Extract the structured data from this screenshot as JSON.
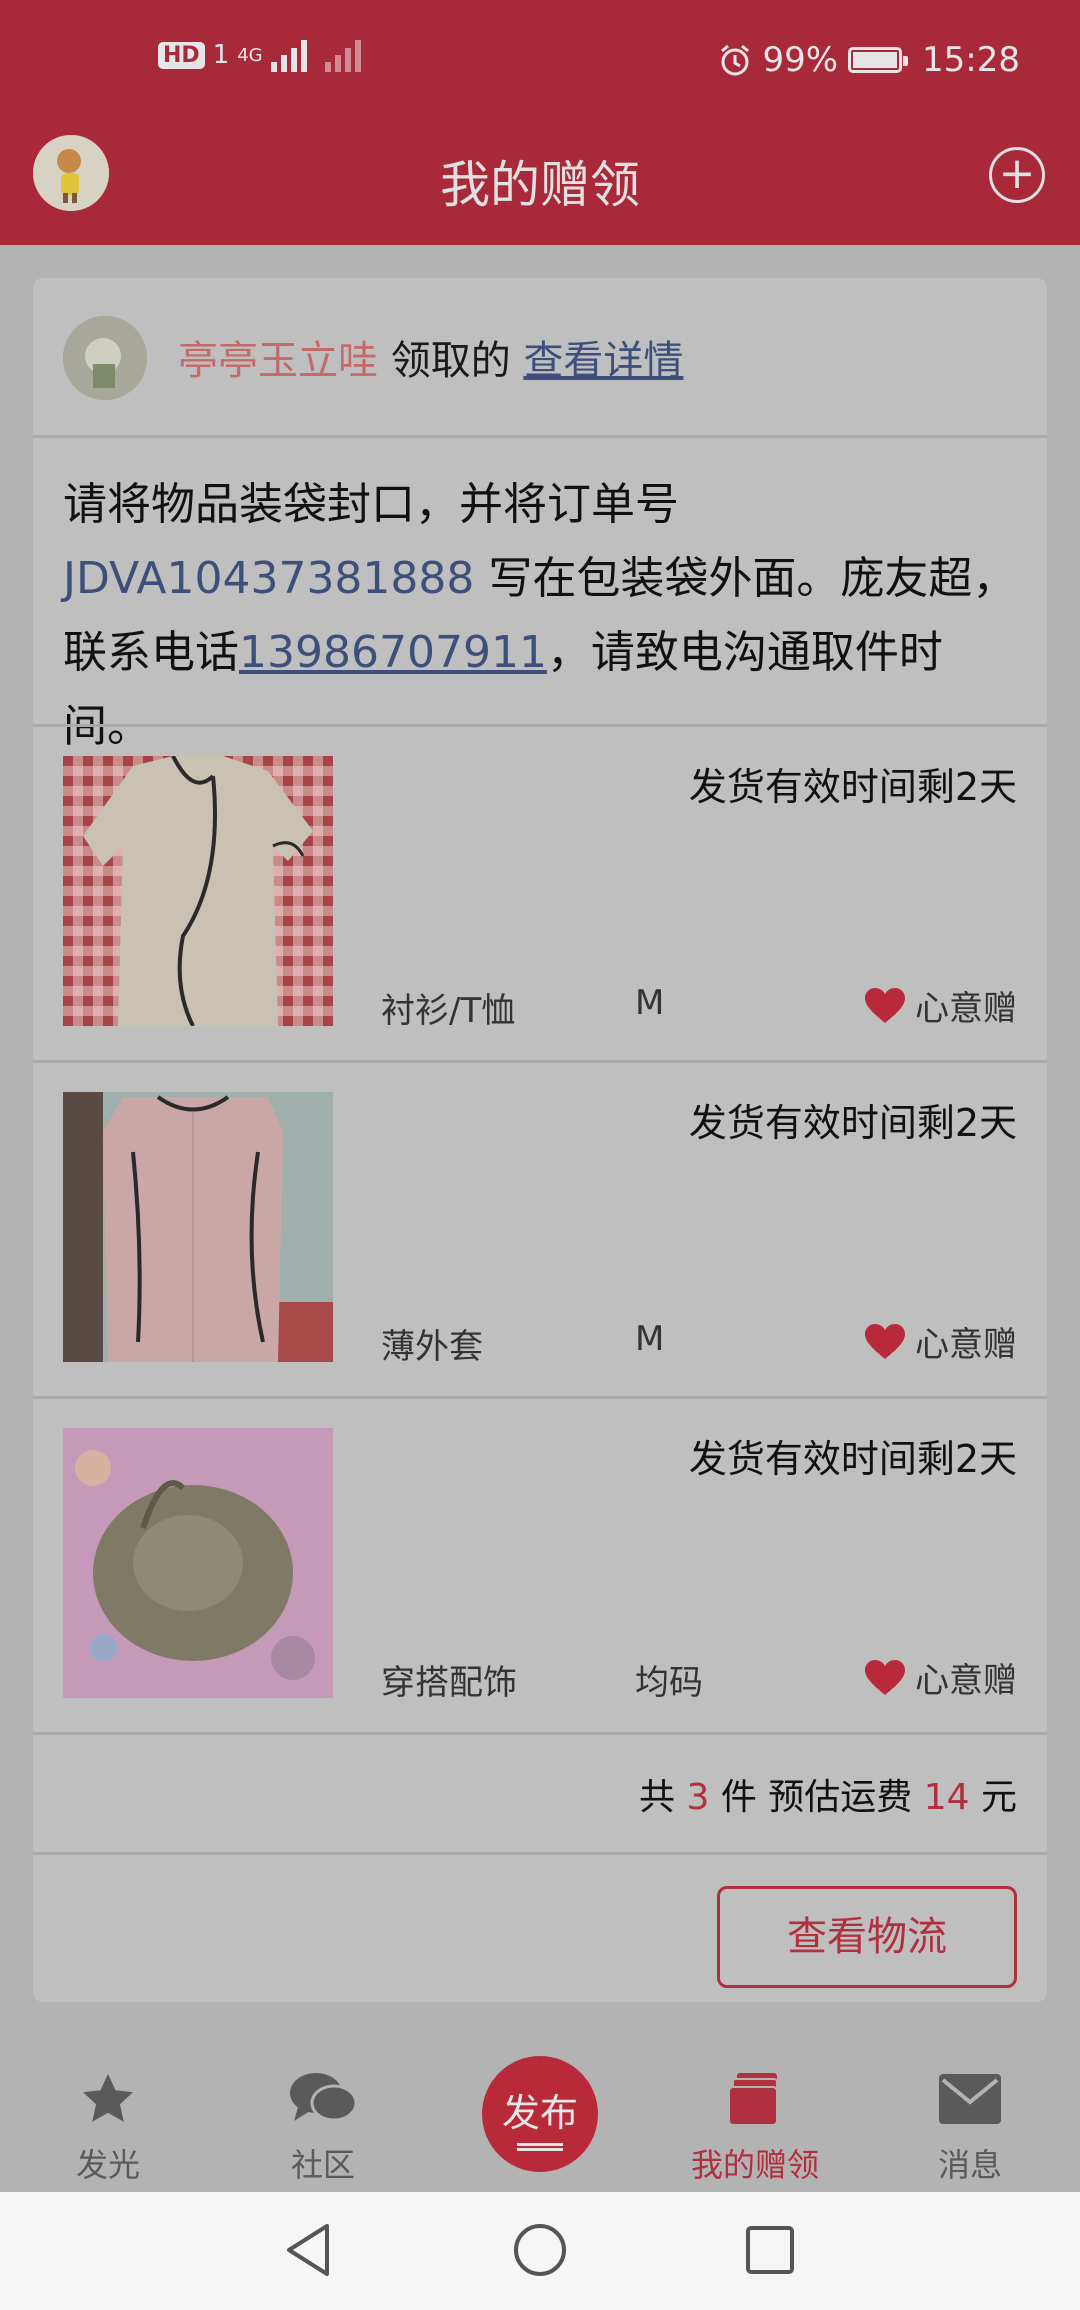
{
  "status_bar": {
    "network": "4G",
    "hd": "HD",
    "sim": "1",
    "battery": "99%",
    "time": "15:28"
  },
  "header": {
    "title": "我的赠领"
  },
  "card": {
    "user_name": "亭亭玉立哇",
    "claimed_text": "领取的",
    "detail_link": "查看详情",
    "notice_part1": "请将物品装袋封口，并将订单号 ",
    "order_number": "JDVA10437381888",
    "notice_part2": " 写在包装袋外面。庞友超，联系电话",
    "phone": "13986707911",
    "notice_part3": "，请致电沟通取件时间。",
    "items": [
      {
        "remaining": "发货有效时间剩2天",
        "category": "衬衫/T恤",
        "size": "M",
        "gift_type": "心意赠"
      },
      {
        "remaining": "发货有效时间剩2天",
        "category": "薄外套",
        "size": "M",
        "gift_type": "心意赠"
      },
      {
        "remaining": "发货有效时间剩2天",
        "category": "穿搭配饰",
        "size": "均码",
        "gift_type": "心意赠"
      }
    ],
    "total": {
      "prefix": "共",
      "count": "3",
      "mid": "件 预估运费",
      "fee": "14",
      "suffix": "元"
    },
    "logistics_button": "查看物流"
  },
  "bottom_nav": {
    "items": [
      {
        "label": "发光",
        "icon": "star-icon"
      },
      {
        "label": "社区",
        "icon": "chat-icon"
      },
      {
        "label": "发布",
        "icon": "publish-icon"
      },
      {
        "label": "我的赠领",
        "icon": "gift-cards-icon"
      },
      {
        "label": "消息",
        "icon": "mail-icon"
      }
    ]
  },
  "colors": {
    "brand": "#a82a3a",
    "accent_red": "#b03040",
    "link_blue": "#3d4f7a"
  }
}
